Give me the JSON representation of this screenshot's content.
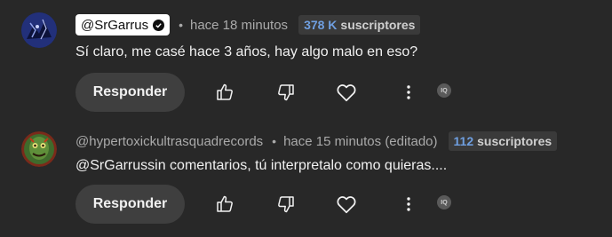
{
  "comments": [
    {
      "author": "@SrGarrus",
      "verified": true,
      "separator": "•",
      "time": "hace 18 minutos",
      "subscribers_count": "378 K",
      "subscribers_label": "suscriptores",
      "text": "Sí claro, me casé hace 3 años, hay algo malo en eso?",
      "reply_label": "Responder",
      "ext_badge": "IQ"
    },
    {
      "author": "@hypertoxickultrasquadrecords",
      "verified": false,
      "separator": "•",
      "time": "hace 15 minutos (editado)",
      "subscribers_count": "112",
      "subscribers_label": "suscriptores",
      "text": "@SrGarrussin comentarios, tú interpretalo como quieras....",
      "reply_label": "Responder",
      "ext_badge": "IQ"
    }
  ],
  "icons": {
    "like": "thumbs-up-icon",
    "dislike": "thumbs-down-icon",
    "heart": "heart-icon",
    "more": "more-vert-icon"
  },
  "colors": {
    "background": "#282828",
    "subscriber_count": "#6f9fe0",
    "button_bg": "#3f3f3f"
  }
}
